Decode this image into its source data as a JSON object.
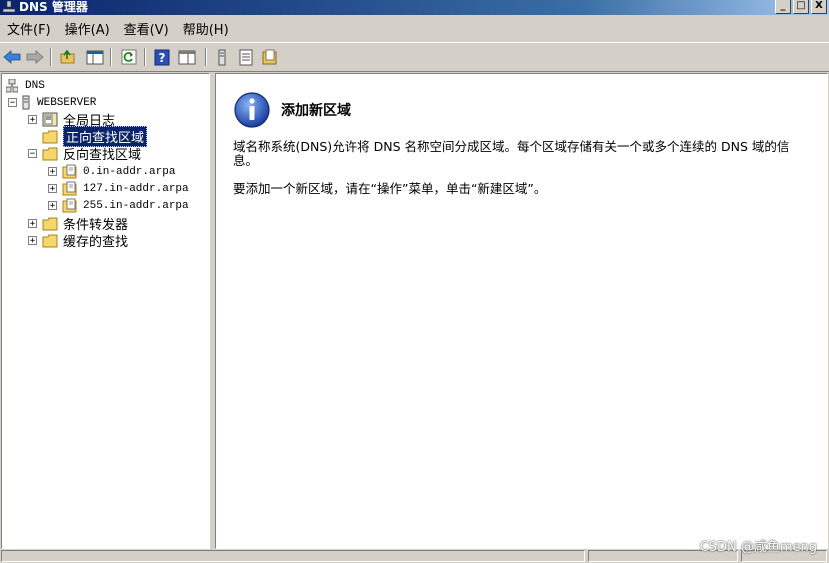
{
  "window": {
    "title": "DNS 管理器",
    "buttons": [
      "_",
      "□",
      "X"
    ]
  },
  "menu": [
    {
      "label": "文件(F)"
    },
    {
      "label": "操作(A)"
    },
    {
      "label": "查看(V)"
    },
    {
      "label": "帮助(H)"
    }
  ],
  "toolbar": {
    "icons": [
      "back-arrow-icon",
      "forward-arrow-icon",
      "up-folder-icon",
      "show-hide-tree-icon",
      "refresh-icon",
      "help-icon",
      "properties-icon",
      "server-icon",
      "list-icon",
      "zone-icon"
    ]
  },
  "tree": {
    "root": "DNS",
    "server": "WEBSERVER",
    "global_logs": "全局日志",
    "forward_zones": "正向查找区域",
    "reverse_zones": "反向查找区域",
    "reverse_children": [
      "0.in-addr.arpa",
      "127.in-addr.arpa",
      "255.in-addr.arpa"
    ],
    "conditional_forwarders": "条件转发器",
    "cached_lookups": "缓存的查找"
  },
  "content": {
    "heading": "添加新区域",
    "description": "域名称系统(DNS)允许将 DNS 名称空间分成区域。每个区域存储有关一个或多个连续的 DNS 域的信息。",
    "instruction": "要添加一个新区域，请在“操作”菜单，单击“新建区域”。"
  },
  "watermark": "CSDN @咸鱼meng"
}
